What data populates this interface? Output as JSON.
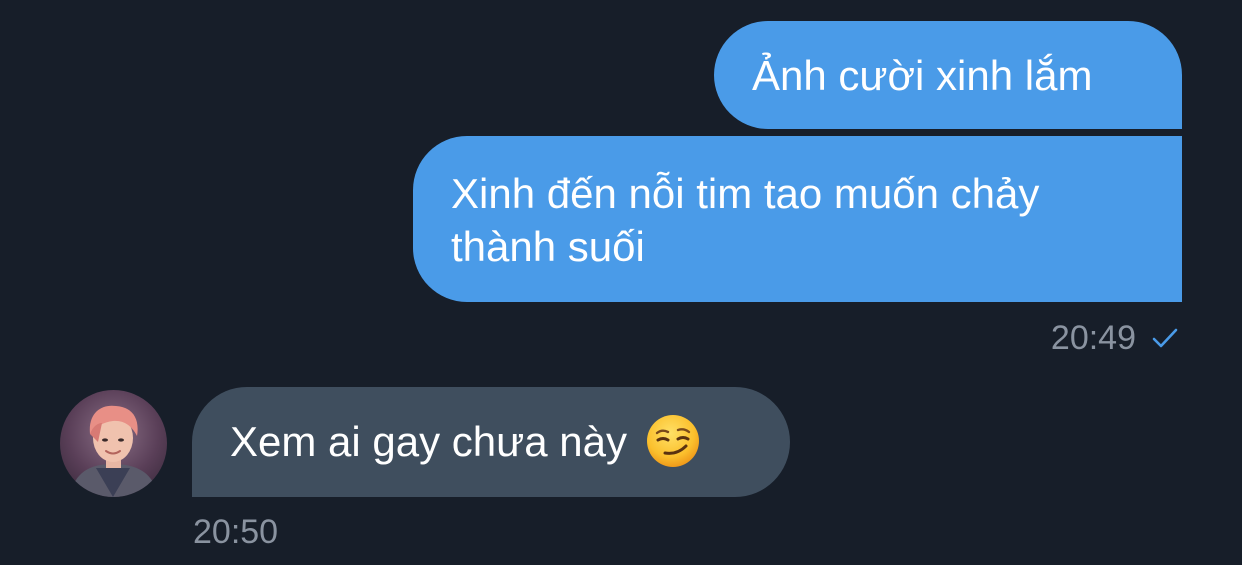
{
  "conversation": {
    "outgoing": {
      "messages": [
        {
          "text": "Ảnh cười xinh lắm"
        },
        {
          "text": "Xinh đến nỗi tim tao muốn chảy thành suối"
        }
      ],
      "time": "20:49",
      "status_icon": "single-check-icon"
    },
    "incoming": {
      "avatar_icon": "profile-photo",
      "messages": [
        {
          "text": "Xem ai gay chưa này",
          "emoji_icon": "smirking-face-emoji"
        }
      ],
      "time": "20:50"
    }
  },
  "colors": {
    "background": "#171e29",
    "outgoing_bubble": "#4a9be8",
    "incoming_bubble": "#3f4e5e",
    "timestamp": "#8a93a0",
    "check": "#4a9be8"
  }
}
